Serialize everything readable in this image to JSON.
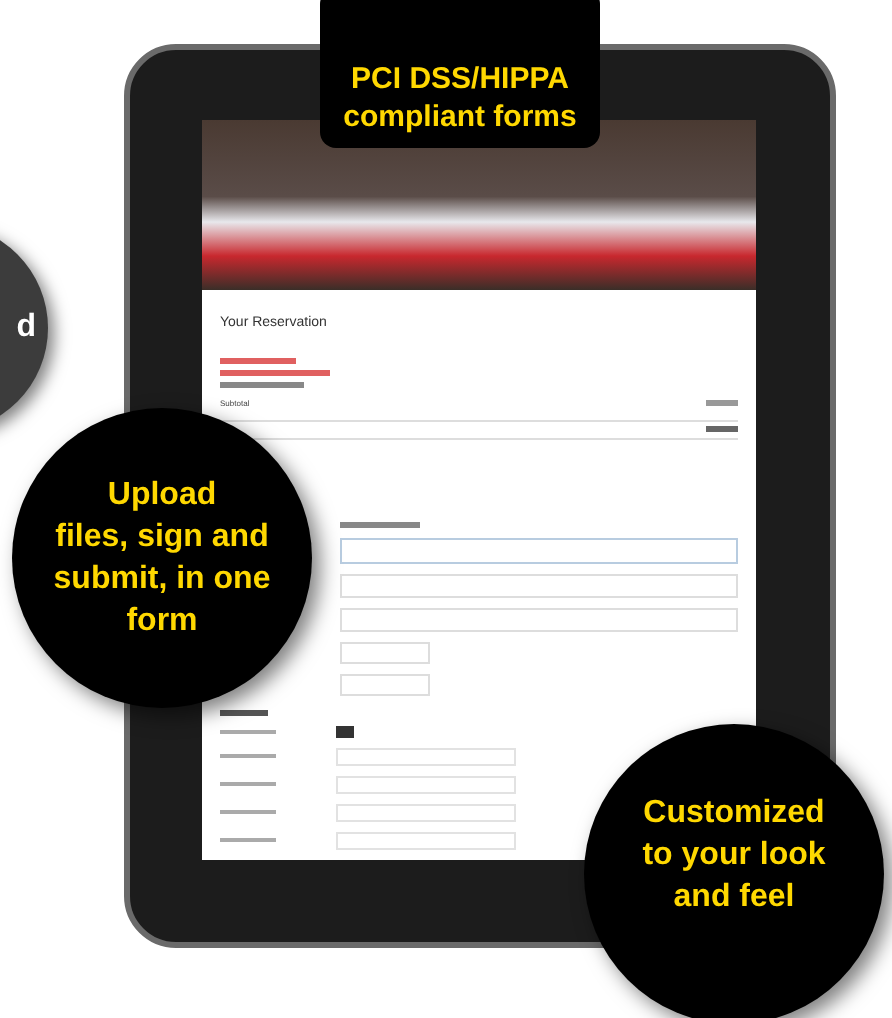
{
  "top_label": {
    "lines": [
      "PCI DSS/HIPPA",
      "compliant forms"
    ]
  },
  "callouts": [
    {
      "kind": "side",
      "lines": [
        "d"
      ]
    },
    {
      "kind": "left",
      "lines": [
        "Upload",
        "files, sign and",
        "submit, in one",
        "form"
      ]
    },
    {
      "kind": "right",
      "lines": [
        "Customized",
        "to your look",
        "and feel"
      ]
    }
  ],
  "form": {
    "title": "Your Reservation",
    "subtotal_label": "Subtotal"
  }
}
